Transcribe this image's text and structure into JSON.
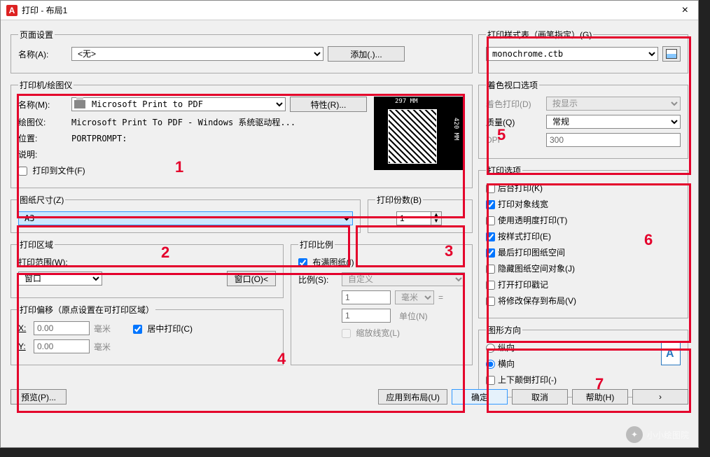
{
  "window": {
    "title": "打印 - 布局1"
  },
  "page_setup": {
    "legend": "页面设置",
    "name_label": "名称(A):",
    "name_value": "<无>",
    "add_button": "添加(.)..."
  },
  "printer": {
    "legend": "打印机/绘图仪",
    "name_label": "名称(M):",
    "name_value": "Microsoft Print to PDF",
    "props_button": "特性(R)...",
    "plotter_label": "绘图仪:",
    "plotter_value": "Microsoft Print To PDF - Windows 系统驱动程...",
    "location_label": "位置:",
    "location_value": "PORTPROMPT:",
    "desc_label": "说明:",
    "desc_value": "",
    "to_file_label": "打印到文件(F)",
    "preview_w": "297 MM",
    "preview_h": "420 MM"
  },
  "paper": {
    "legend": "图纸尺寸(Z)",
    "value": "A3"
  },
  "copies": {
    "legend": "打印份数(B)",
    "value": "1"
  },
  "area": {
    "legend": "打印区域",
    "what_label": "打印范围(W):",
    "what_value": "窗口",
    "window_button": "窗口(O)<"
  },
  "offset": {
    "legend": "打印偏移（原点设置在可打印区域）",
    "x_label": "X:",
    "x_value": "0.00",
    "y_label": "Y:",
    "y_value": "0.00",
    "unit": "毫米",
    "center_label": "居中打印(C)"
  },
  "scale": {
    "legend": "打印比例",
    "fit_label": "布满图纸(I)",
    "scale_label": "比例(S):",
    "scale_value": "自定义",
    "num_value": "1",
    "num_unit": "毫米",
    "den_value": "1",
    "den_unit": "单位(N)",
    "lw_label": "缩放线宽(L)"
  },
  "styletable": {
    "legend": "打印样式表（画笔指定）(G)",
    "value": "monochrome.ctb"
  },
  "shaded": {
    "legend": "着色视口选项",
    "shade_label": "着色打印(D)",
    "shade_value": "按显示",
    "quality_label": "质量(Q)",
    "quality_value": "常规",
    "dpi_label": "DPI",
    "dpi_value": "300"
  },
  "options": {
    "legend": "打印选项",
    "bg": "后台打印(K)",
    "lw": "打印对象线宽",
    "trans": "使用透明度打印(T)",
    "styles": "按样式打印(E)",
    "paperspace": "最后打印图纸空间",
    "hide": "隐藏图纸空间对象(J)",
    "stamp": "打开打印戳记",
    "save": "将修改保存到布局(V)"
  },
  "orient": {
    "legend": "图形方向",
    "portrait": "纵向",
    "landscape": "横向",
    "upside": "上下颠倒打印(-)"
  },
  "buttons": {
    "preview": "预览(P)...",
    "apply": "应用到布局(U)",
    "ok": "确定",
    "cancel": "取消",
    "help": "帮助(H)"
  },
  "annotations": {
    "n1": "1",
    "n2": "2",
    "n3": "3",
    "n4": "4",
    "n5": "5",
    "n6": "6",
    "n7": "7"
  },
  "watermark": "小小绘图院"
}
